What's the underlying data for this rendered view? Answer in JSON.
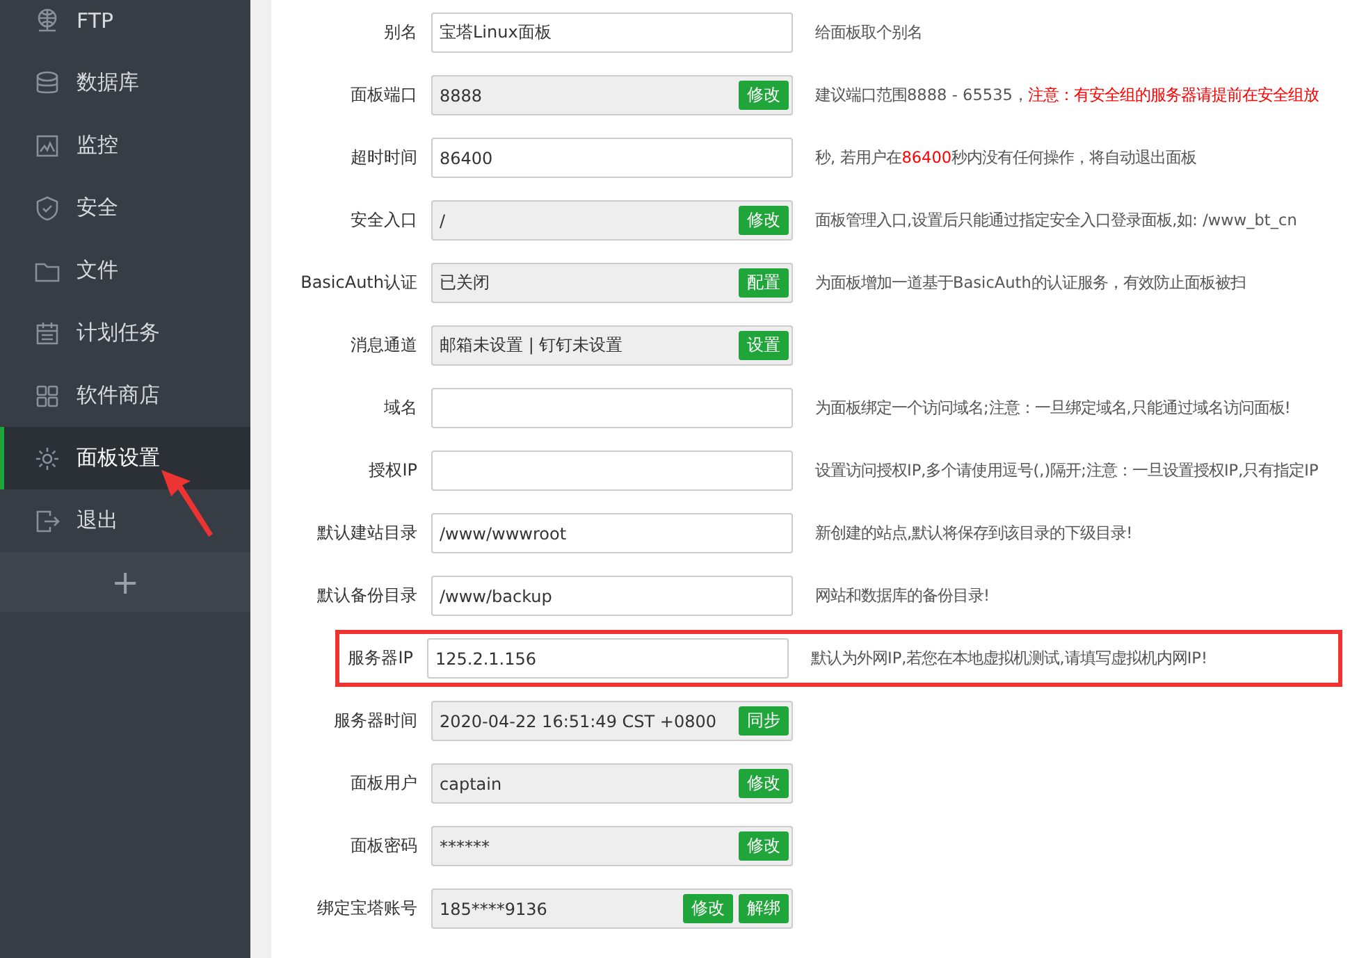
{
  "sidebar": {
    "items": [
      {
        "label": "FTP",
        "selected": false
      },
      {
        "label": "数据库",
        "selected": false
      },
      {
        "label": "监控",
        "selected": false
      },
      {
        "label": "安全",
        "selected": false
      },
      {
        "label": "文件",
        "selected": false
      },
      {
        "label": "计划任务",
        "selected": false
      },
      {
        "label": "软件商店",
        "selected": false
      },
      {
        "label": "面板设置",
        "selected": true
      },
      {
        "label": "退出",
        "selected": false
      }
    ],
    "add_button": "+"
  },
  "settings": [
    {
      "label": "别名",
      "kind": "input",
      "value": "宝塔Linux面板",
      "highlighted": false,
      "description": [
        {
          "text": "给面板取个别名",
          "warning": false
        }
      ]
    },
    {
      "label": "面板端口",
      "kind": "readonly",
      "value": "8888",
      "buttons": [
        "修改"
      ],
      "highlighted": false,
      "description": [
        {
          "text": "建议端口范围8888 - 65535，",
          "warning": false
        },
        {
          "text": "注意：有安全组的服务器请提前在安全组放",
          "warning": true
        }
      ]
    },
    {
      "label": "超时时间",
      "kind": "input",
      "value": "86400",
      "highlighted": false,
      "description": [
        {
          "text": "秒, 若用户在",
          "warning": false
        },
        {
          "text": "86400",
          "warning": true
        },
        {
          "text": "秒内没有任何操作，将自动退出面板",
          "warning": false
        }
      ]
    },
    {
      "label": "安全入口",
      "kind": "readonly",
      "value": "/",
      "buttons": [
        "修改"
      ],
      "highlighted": false,
      "description": [
        {
          "text": "面板管理入口,设置后只能通过指定安全入口登录面板,如: /www_bt_cn",
          "warning": false
        }
      ]
    },
    {
      "label": "BasicAuth认证",
      "kind": "readonly",
      "value": "已关闭",
      "buttons": [
        "配置"
      ],
      "highlighted": false,
      "description": [
        {
          "text": "为面板增加一道基于BasicAuth的认证服务，有效防止面板被扫",
          "warning": false
        }
      ]
    },
    {
      "label": "消息通道",
      "kind": "readonly",
      "value": "邮箱未设置 | 钉钉未设置",
      "buttons": [
        "设置"
      ],
      "highlighted": false
    },
    {
      "label": "域名",
      "kind": "input",
      "highlighted": false,
      "description": [
        {
          "text": "为面板绑定一个访问域名;注意：一旦绑定域名,只能通过域名访问面板!",
          "warning": false
        }
      ]
    },
    {
      "label": "授权IP",
      "kind": "input",
      "highlighted": false,
      "description": [
        {
          "text": "设置访问授权IP,多个请使用逗号(,)隔开;注意：一旦设置授权IP,只有指定IP",
          "warning": false
        }
      ]
    },
    {
      "label": "默认建站目录",
      "kind": "input",
      "value": "/www/wwwroot",
      "highlighted": false,
      "description": [
        {
          "text": "新创建的站点,默认将保存到该目录的下级目录!",
          "warning": false
        }
      ]
    },
    {
      "label": "默认备份目录",
      "kind": "input",
      "value": "/www/backup",
      "highlighted": false,
      "description": [
        {
          "text": "网站和数据库的备份目录!",
          "warning": false
        }
      ]
    },
    {
      "label": "服务器IP",
      "kind": "input",
      "value": "125.2.1.156",
      "highlighted": true,
      "description": [
        {
          "text": "默认为外网IP,若您在本地虚拟机测试,请填写虚拟机内网IP!",
          "warning": false
        }
      ]
    },
    {
      "label": "服务器时间",
      "kind": "readonly",
      "value": "2020-04-22 16:51:49 CST +0800",
      "buttons": [
        "同步"
      ],
      "highlighted": false
    },
    {
      "label": "面板用户",
      "kind": "readonly",
      "value": "captain",
      "buttons": [
        "修改"
      ],
      "highlighted": false
    },
    {
      "label": "面板密码",
      "kind": "readonly",
      "value": "******",
      "buttons": [
        "修改"
      ],
      "highlighted": false
    },
    {
      "label": "绑定宝塔账号",
      "kind": "readonly",
      "value": "185****9136",
      "buttons": [
        "修改",
        "解绑"
      ],
      "highlighted": false
    }
  ]
}
